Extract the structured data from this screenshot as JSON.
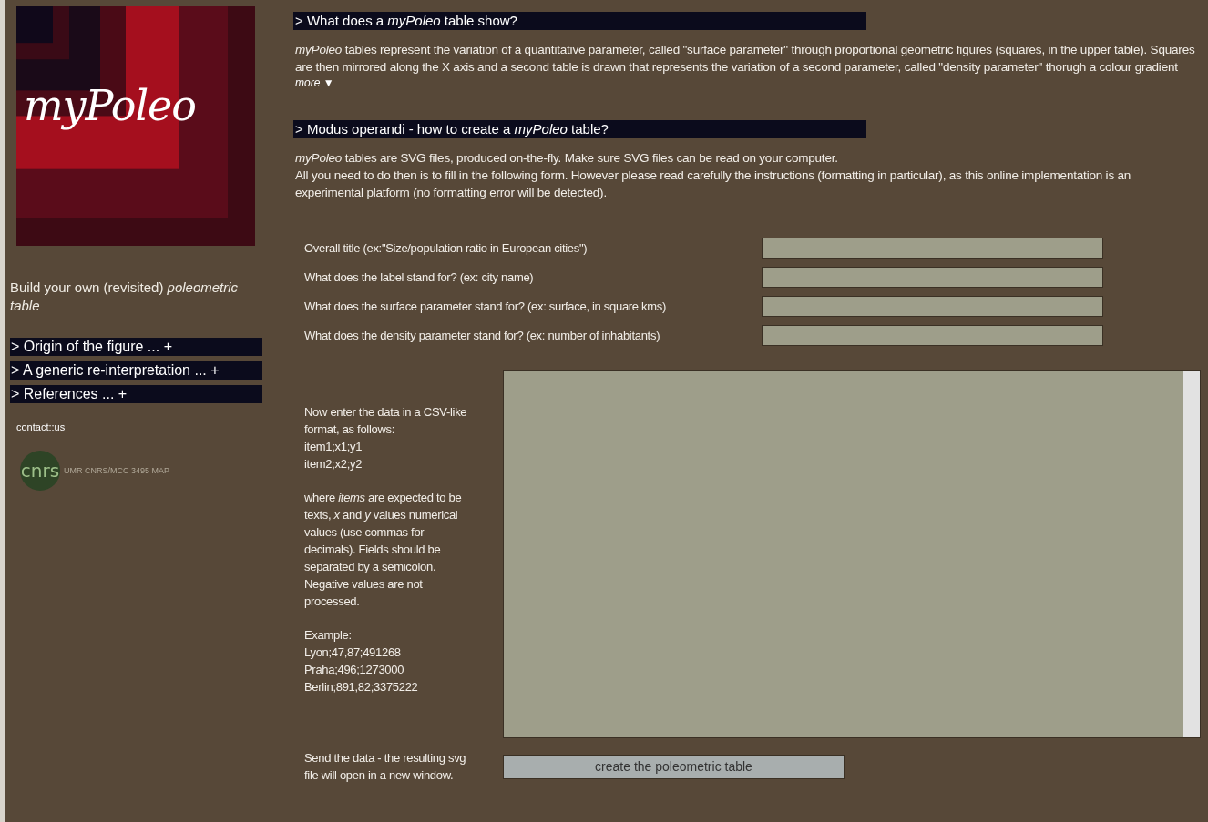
{
  "sidebar": {
    "logo": {
      "text": "myPoleo"
    },
    "tagline": "Build your own (revisited) *poleometric table*",
    "sections": [
      {
        "label": "> Origin of the figure ... +",
        "expanded": false
      },
      {
        "label": "> A generic re-interpretation ... +",
        "expanded": false
      },
      {
        "label": "> References ... +",
        "expanded": false
      }
    ],
    "contact_link": "contact::us",
    "badge": {
      "logo_text": "cnrs",
      "caption": "UMR CNRS/MCC 3495 MAP"
    }
  },
  "sections": [
    {
      "heading": "> What does a *myPoleo* table show?",
      "paragraphs": [
        [
          "*myPoleo* tables represent the variation of a quantitative parameter, called \"surface parameter\" through proportional geometric figures (squares, in the upper table). Squares are then mirrored along the X axis and a second table is drawn that represents the variation of a second parameter, called \"density parameter\" thorugh a colour gradient"
        ]
      ],
      "more_link": "more ▼"
    },
    {
      "heading": "> Modus operandi - how to create a *myPoleo* table?",
      "paragraphs": [
        [
          "*myPoleo* tables are SVG files, produced on-the-fly. Make sure SVG files can be read on your computer.",
          "All you need to do then is to fill in the following form. However please read carefully the instructions (formatting in particular), as this online implementation is an experimental platform (no formatting error will be detected)."
        ]
      ]
    }
  ],
  "form": {
    "fields": [
      {
        "label": "Overall title (ex:\"Size/population ratio in European cities\")"
      },
      {
        "label": "What does the label stand for? (ex: city name)"
      },
      {
        "label": "What does the surface parameter stand for? (ex: surface, in square kms)"
      },
      {
        "label": "What does the density parameter stand for? (ex: number of inhabitants)"
      }
    ],
    "data_instructions": [
      [
        "Now enter the data in a CSV-like format, as follows:",
        "item1;x1;y1",
        "item2;x2;y2"
      ],
      [
        "where *items* are expected to be texts, *x* and *y* values numerical values (use commas for decimals). Fields should be separated by a semicolon. Negative values are not processed."
      ],
      [
        "Example:",
        "Lyon;47,87;491268",
        "Praha;496;1273000",
        "Berlin;891,82;3375222"
      ]
    ],
    "submit_note": "Send the data - the resulting svg file will open in a new window.",
    "submit_button": "create the poleometric table"
  }
}
